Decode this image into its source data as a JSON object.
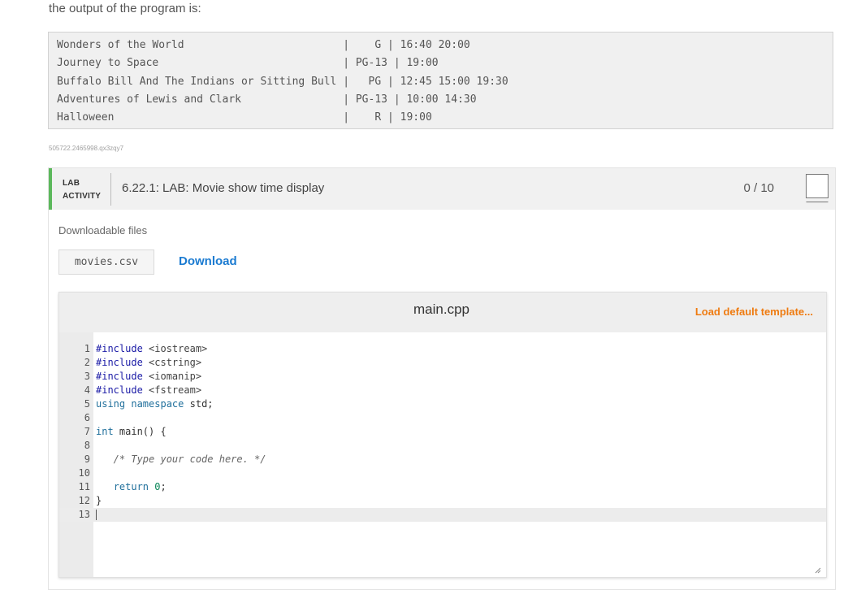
{
  "intro_text": "the output of the program is:",
  "output_lines": [
    "Wonders of the World                         |    G | 16:40 20:00",
    "Journey to Space                             | PG-13 | 19:00",
    "Buffalo Bill And The Indians or Sitting Bull |   PG | 12:45 15:00 19:30",
    "Adventures of Lewis and Clark                | PG-13 | 10:00 14:30",
    "Halloween                                    |    R | 19:00"
  ],
  "activity_id": "505722.2465998.qx3zqy7",
  "lab": {
    "tag_line1": "LAB",
    "tag_line2": "ACTIVITY",
    "title": "6.22.1: LAB: Movie show time display",
    "score": "0 / 10",
    "accent_color": "#5cb85c"
  },
  "downloads": {
    "label": "Downloadable files",
    "file_name": "movies.csv",
    "download_label": "Download"
  },
  "editor": {
    "filename": "main.cpp",
    "load_template_label": "Load default template...",
    "lines": [
      {
        "n": "1",
        "text": "#include <iostream>"
      },
      {
        "n": "2",
        "text": "#include <cstring>"
      },
      {
        "n": "3",
        "text": "#include <iomanip>"
      },
      {
        "n": "4",
        "text": "#include <fstream>"
      },
      {
        "n": "5",
        "text": "using namespace std;"
      },
      {
        "n": "6",
        "text": ""
      },
      {
        "n": "7",
        "text": "int main() {"
      },
      {
        "n": "8",
        "text": ""
      },
      {
        "n": "9",
        "text": "   /* Type your code here. */"
      },
      {
        "n": "10",
        "text": ""
      },
      {
        "n": "11",
        "text": "   return 0;"
      },
      {
        "n": "12",
        "text": "}"
      },
      {
        "n": "13",
        "text": ""
      }
    ],
    "active_line": 13
  },
  "icons": {
    "score_badge": "score-badge-icon",
    "resize": "resize-grip-icon"
  }
}
